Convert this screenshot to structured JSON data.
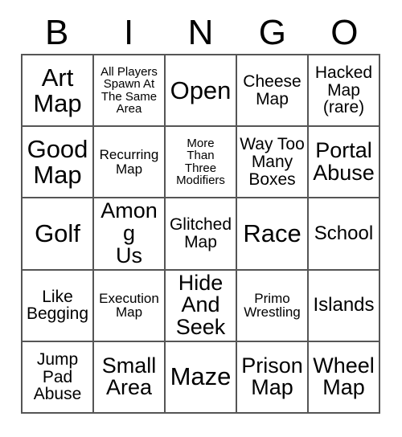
{
  "card": {
    "title": "BINGO",
    "header_letters": [
      "B",
      "I",
      "N",
      "G",
      "O"
    ],
    "colors": {
      "background": "#ffffff",
      "text": "#000000",
      "grid_line": "#555555"
    },
    "grid": {
      "columns": 5,
      "rows": 5,
      "cells": [
        {
          "text": "Art\nMap",
          "size": "fs-xxl"
        },
        {
          "text": "All Players\nSpawn At\nThe Same\nArea",
          "size": "fs-xs"
        },
        {
          "text": "Open",
          "size": "fs-xxl"
        },
        {
          "text": "Cheese\nMap",
          "size": "fs-md"
        },
        {
          "text": "Hacked\nMap\n(rare)",
          "size": "fs-md"
        },
        {
          "text": "Good\nMap",
          "size": "fs-xxl"
        },
        {
          "text": "Recurring\nMap",
          "size": "fs-sm"
        },
        {
          "text": "More\nThan\nThree\nModifiers",
          "size": "fs-xs"
        },
        {
          "text": "Way Too\nMany\nBoxes",
          "size": "fs-md"
        },
        {
          "text": "Portal\nAbuse",
          "size": "fs-xl"
        },
        {
          "text": "Golf",
          "size": "fs-xxl"
        },
        {
          "text": "Among\nUs",
          "size": "fs-xl"
        },
        {
          "text": "Glitched\nMap",
          "size": "fs-md"
        },
        {
          "text": "Race",
          "size": "fs-xxl"
        },
        {
          "text": "School",
          "size": "fs-lg"
        },
        {
          "text": "Like\nBegging",
          "size": "fs-md"
        },
        {
          "text": "Execution\nMap",
          "size": "fs-sm"
        },
        {
          "text": "Hide\nAnd\nSeek",
          "size": "fs-xl"
        },
        {
          "text": "Primo\nWrestling",
          "size": "fs-sm"
        },
        {
          "text": "Islands",
          "size": "fs-lg"
        },
        {
          "text": "Jump\nPad\nAbuse",
          "size": "fs-md"
        },
        {
          "text": "Small\nArea",
          "size": "fs-xl"
        },
        {
          "text": "Maze",
          "size": "fs-xxl"
        },
        {
          "text": "Prison\nMap",
          "size": "fs-xl"
        },
        {
          "text": "Wheel\nMap",
          "size": "fs-xl"
        }
      ]
    }
  }
}
